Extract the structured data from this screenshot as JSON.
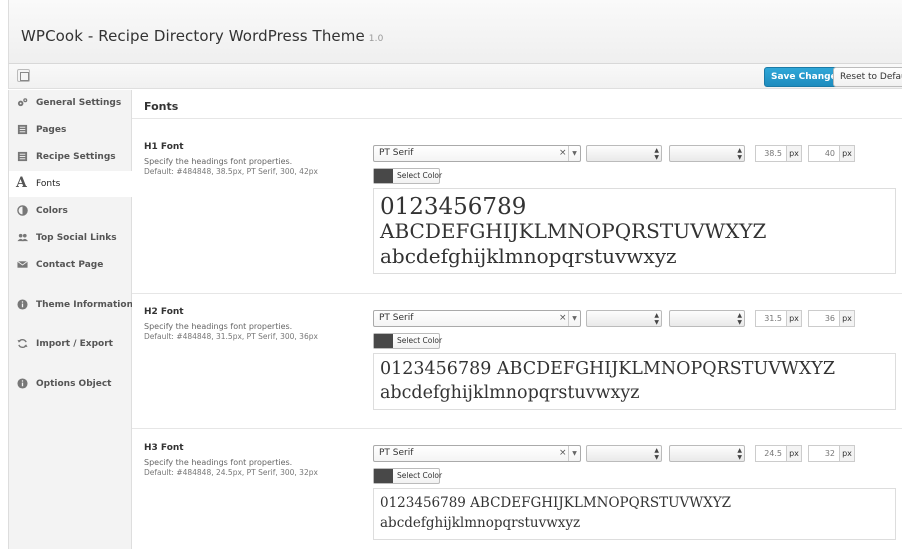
{
  "app": {
    "title": "WPCook - Recipe Directory WordPress Theme",
    "version": "1.0"
  },
  "toolbar": {
    "save_label": "Save Changes",
    "reset_label": "Reset to Defaults"
  },
  "sidebar": {
    "items": [
      {
        "label": "General Settings",
        "icon": "gears-icon"
      },
      {
        "label": "Pages",
        "icon": "pages-icon"
      },
      {
        "label": "Recipe Settings",
        "icon": "recipe-settings-icon"
      },
      {
        "label": "Fonts",
        "icon": "font-icon",
        "active": true
      },
      {
        "label": "Colors",
        "icon": "contrast-icon"
      },
      {
        "label": "Top Social Links",
        "icon": "users-icon"
      },
      {
        "label": "Contact Page",
        "icon": "envelope-icon"
      },
      {
        "label": "Theme Information",
        "icon": "info-icon"
      },
      {
        "label": "Import / Export",
        "icon": "refresh-icon"
      },
      {
        "label": "Options Object",
        "icon": "info-icon"
      }
    ]
  },
  "main": {
    "section_title": "Fonts",
    "fonts": [
      {
        "title": "H1 Font",
        "desc": "Specify the headings font properties.",
        "default": "Default: #484848, 38.5px, PT Serif, 300, 42px",
        "family": "PT Serif",
        "size": "38.5",
        "line_height": "40",
        "unit": "px",
        "color_label": "Select Color",
        "color": "#484848",
        "preview_lines": [
          "0123456789",
          "ABCDEFGHIJKLMNOPQRSTUVWXYZ",
          "abcdefghijklmnopqrstuvwxyz"
        ]
      },
      {
        "title": "H2 Font",
        "desc": "Specify the headings font properties.",
        "default": "Default: #484848, 31.5px, PT Serif, 300, 36px",
        "family": "PT Serif",
        "size": "31.5",
        "line_height": "36",
        "unit": "px",
        "color_label": "Select Color",
        "color": "#484848",
        "preview_lines": [
          "0123456789 ABCDEFGHIJKLMNOPQRSTUVWXYZ",
          "abcdefghijklmnopqrstuvwxyz"
        ]
      },
      {
        "title": "H3 Font",
        "desc": "Specify the headings font properties.",
        "default": "Default: #484848, 24.5px, PT Serif, 300, 32px",
        "family": "PT Serif",
        "size": "24.5",
        "line_height": "32",
        "unit": "px",
        "color_label": "Select Color",
        "color": "#484848",
        "preview_lines": [
          "0123456789 ABCDEFGHIJKLMNOPQRSTUVWXYZ",
          "abcdefghijklmnopqrstuvwxyz"
        ]
      }
    ]
  },
  "colors": {
    "accent": "#1e8cbe",
    "swatch": "#484848"
  }
}
